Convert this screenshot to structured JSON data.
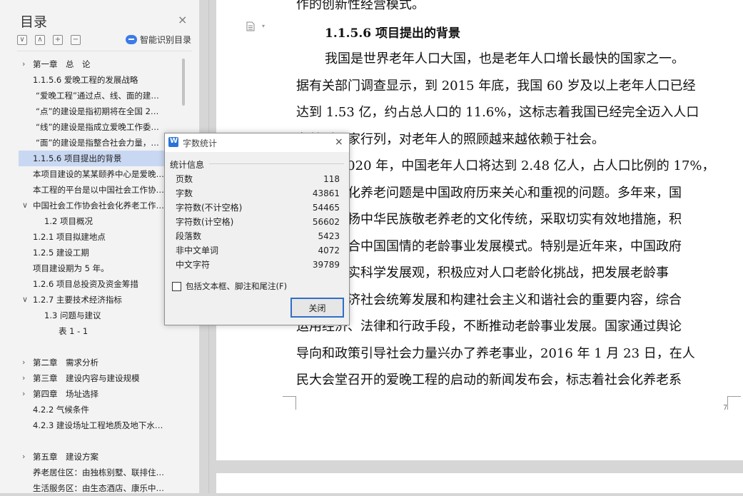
{
  "sidebar": {
    "title": "目录",
    "close_glyph": "×",
    "tools": [
      "∨",
      "∧",
      "+",
      "−"
    ],
    "smart_toc_label": "智能识别目录",
    "toc": [
      {
        "label": "第一章　总　论",
        "level": 0,
        "chevron": "›"
      },
      {
        "label": "1.1.5.6  爱晚工程的发展战略",
        "level": 1
      },
      {
        "label": "“爱晚工程”通过点、线、面的建…",
        "level": 2
      },
      {
        "label": "“点”的建设是指初期将在全国 2…",
        "level": 2
      },
      {
        "label": "“线”的建设是指成立爱晚工作委…",
        "level": 2
      },
      {
        "label": "“面”的建设是指整合社会力量，…",
        "level": 2
      },
      {
        "label": "1.1.5.6  项目提出的背景",
        "level": 1,
        "selected": true
      },
      {
        "label": "本项目建设的某某颐养中心是爱晚…",
        "level": 0
      },
      {
        "label": "本工程的平台是以中国社会工作协…",
        "level": 0
      },
      {
        "label": "中国社会工作协会社会化养老工作…",
        "level": 0,
        "chevron": "∨"
      },
      {
        "label": "1.2  项目概况",
        "level": 3
      },
      {
        "label": "1.2.1  项目拟建地点",
        "level": 1
      },
      {
        "label": "1.2.5  建设工期",
        "level": 1
      },
      {
        "label": "项目建设期为 5 年。",
        "level": 0
      },
      {
        "label": "1.2.6  项目总投资及资金筹措",
        "level": 1
      },
      {
        "label": "1.2.7  主要技术经济指标",
        "level": 1,
        "chevron": "∨"
      },
      {
        "label": "1.3  问题与建议",
        "level": 3
      },
      {
        "label": "表 1 - 1",
        "level": 4
      },
      {
        "label": "第二章　需求分析",
        "level": 0,
        "chevron": "›",
        "gap": true
      },
      {
        "label": "第三章　建设内容与建设规模",
        "level": 0,
        "chevron": "›"
      },
      {
        "label": "第四章　场址选择",
        "level": 0,
        "chevron": "›"
      },
      {
        "label": "4.2.2  气候条件",
        "level": 1
      },
      {
        "label": "4.2.3  建设场址工程地质及地下水…",
        "level": 1
      },
      {
        "label": "第五章　建设方案",
        "level": 0,
        "chevron": "›",
        "gap": true
      },
      {
        "label": "养老居住区：由独栋别墅、联排住…",
        "level": 0
      },
      {
        "label": "生活服务区：由生态酒店、康乐中…",
        "level": 0
      }
    ]
  },
  "document": {
    "top_partial": "作的创新性经营模式。",
    "heading": "1.1.5.6  项目提出的背景",
    "lines": [
      "我国是世界老年人口大国，也是老年人口增长最快的国家之一。",
      "据有关部门调查显示，到 2015 年底，我国 60 岁及以上老年人口已经",
      "达到 1.53 亿，约占总人口的 11.6%，这标志着我国已经完全迈入人口",
      "老龄型国家行列，对老年人的照顾越来越依赖于社会。",
      "预计到 2020 年，中国老年人口将达到 2.48 亿人，占人口比例的 17%，",
      "人口老龄化养老问题是中国政府历来关心和重视的问题。多年来，国",
      "家为了弘扬中华民族敬老养老的文化传统，采取切实有效地措施，积",
      "极探索符合中国国情的老龄事业发展模式。特别是近年来，中国政府",
      "坚持以落实科学发展观，积极应对人口老龄化挑战，把发展老龄事",
      "业作为经济社会统筹发展和构建社会主义和谐社会的重要内容，综合",
      "运用经济、法律和行政手段，不断推动老龄事业发展。国家通过舆论",
      "导向和政策引导社会力量兴办了养老事业，2016 年 1 月 23 日，在人",
      "民大会堂召开的爱晚工程的启动的新闻发布会，标志着社会化养老系"
    ],
    "page_number": "7"
  },
  "word_count_dialog": {
    "title": "字数统计",
    "close_glyph": "×",
    "group_label": "统计信息",
    "stats": [
      {
        "label": "页数",
        "value": "118"
      },
      {
        "label": "字数",
        "value": "43861"
      },
      {
        "label": "字符数(不计空格)",
        "value": "54465"
      },
      {
        "label": "字符数(计空格)",
        "value": "56602"
      },
      {
        "label": "段落数",
        "value": "5423"
      },
      {
        "label": "非中文单词",
        "value": "4072"
      },
      {
        "label": "中文字符",
        "value": "39789"
      }
    ],
    "checkbox_label": "包括文本框、脚注和尾注(F)",
    "checkbox_checked": false,
    "close_button": "关闭"
  }
}
